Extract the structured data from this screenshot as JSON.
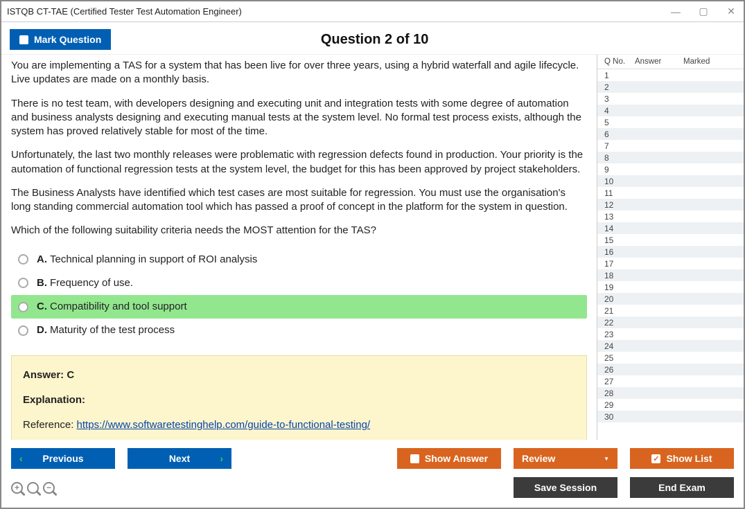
{
  "window": {
    "title": "ISTQB CT-TAE (Certified Tester Test Automation Engineer)"
  },
  "header": {
    "mark_label": "Mark Question",
    "question_title": "Question 2 of 10"
  },
  "question": {
    "paragraphs": [
      "You are implementing a TAS for a system that has been live for over three years, using a hybrid waterfall and agile lifecycle. Live updates are made on a monthly basis.",
      "There is no test team, with developers designing and executing unit and integration tests with some degree of automation and business analysts designing and executing manual tests at the system level. No formal test process exists, although the system has proved relatively stable for most of the time.",
      "Unfortunately, the last two monthly releases were problematic with regression defects found in production. Your priority is the automation of functional regression tests at the system level, the budget for this has been approved by project stakeholders.",
      "The Business Analysts have identified which test cases are most suitable for regression. You must use the organisation's long standing commercial automation tool which has passed a proof of concept in the platform for the system in question.",
      "Which of the following suitability criteria needs the MOST attention for the TAS?"
    ],
    "options": [
      {
        "letter": "A.",
        "text": "Technical planning in support of ROI analysis",
        "correct": false
      },
      {
        "letter": "B.",
        "text": "Frequency of use.",
        "correct": false
      },
      {
        "letter": "C.",
        "text": "Compatibility and tool support",
        "correct": true
      },
      {
        "letter": "D.",
        "text": "Maturity of the test process",
        "correct": false
      }
    ]
  },
  "answer_panel": {
    "answer_label": "Answer: C",
    "explanation_label": "Explanation:",
    "reference_prefix": "Reference: ",
    "reference_url": "https://www.softwaretestinghelp.com/guide-to-functional-testing/"
  },
  "sidebar": {
    "headers": {
      "qno": "Q No.",
      "answer": "Answer",
      "marked": "Marked"
    },
    "row_count": 30
  },
  "footer": {
    "previous": "Previous",
    "next": "Next",
    "show_answer": "Show Answer",
    "review": "Review",
    "show_list": "Show List",
    "save_session": "Save Session",
    "end_exam": "End Exam"
  }
}
